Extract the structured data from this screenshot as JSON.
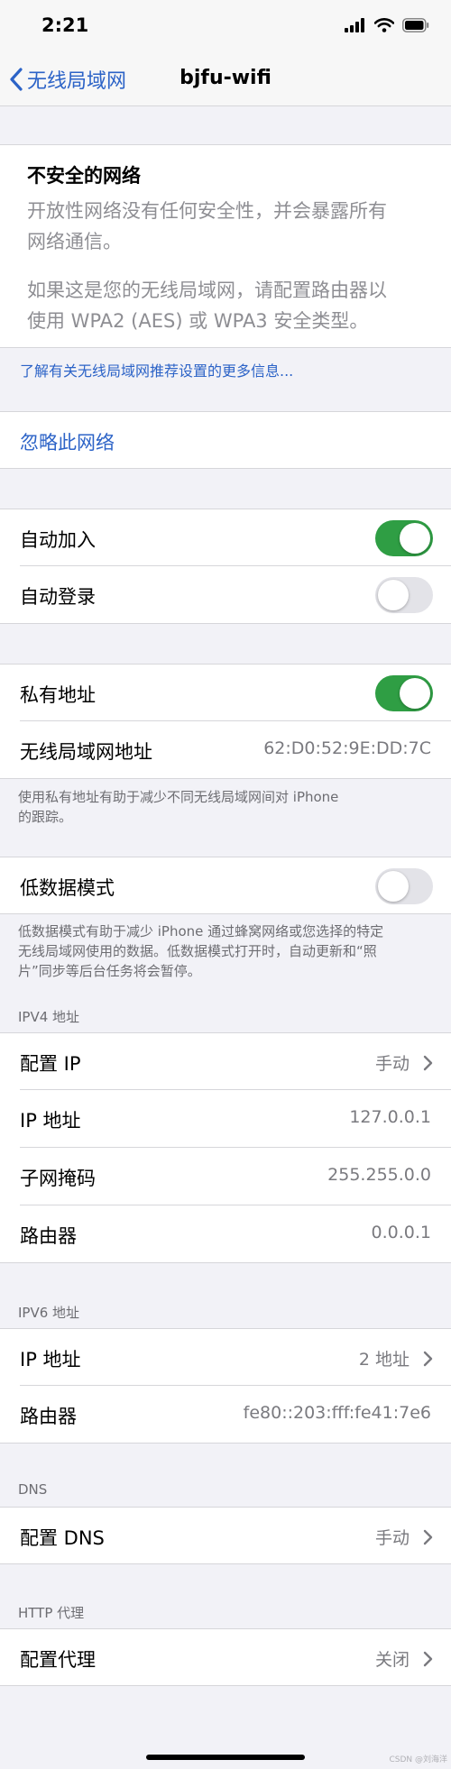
{
  "status_bar": {
    "time": "2:21"
  },
  "nav": {
    "back_label": "无线局域网",
    "title": "bjfu-wifi"
  },
  "warning": {
    "title": "不安全的网络",
    "line1": "开放性网络没有任何安全性，并会暴露所有",
    "line2": "网络通信。",
    "line3": "如果这是您的无线局域网，请配置路由器以",
    "line4": "使用 WPA2 (AES) 或 WPA3 安全类型。"
  },
  "learn_more": "了解有关无线局域网推荐设置的更多信息...",
  "forget_network": "忽略此网络",
  "auto": {
    "auto_join": {
      "label": "自动加入",
      "on": true
    },
    "auto_login": {
      "label": "自动登录",
      "on": false
    }
  },
  "privacy": {
    "private_address": {
      "label": "私有地址",
      "on": true
    },
    "wifi_address": {
      "label": "无线局域网地址",
      "value": "62:D0:52:9E:DD:7C"
    },
    "footnote_line1": "使用私有地址有助于减少不同无线局域网间对 iPhone",
    "footnote_line2": "的跟踪。"
  },
  "low_data": {
    "label": "低数据模式",
    "on": false,
    "footnote_line1": "低数据模式有助于减少 iPhone 通过蜂窝网络或您选择的特定",
    "footnote_line2": "无线局域网使用的数据。低数据模式打开时，自动更新和“照",
    "footnote_line3": "片”同步等后台任务将会暂停。"
  },
  "ipv4": {
    "header": "IPV4 地址",
    "configure_ip": {
      "label": "配置 IP",
      "value": "手动"
    },
    "ip_address": {
      "label": "IP 地址",
      "value": "127.0.0.1"
    },
    "subnet_mask": {
      "label": "子网掩码",
      "value": "255.255.0.0"
    },
    "router": {
      "label": "路由器",
      "value": "0.0.0.1"
    }
  },
  "ipv6": {
    "header": "IPV6 地址",
    "ip_address": {
      "label": "IP 地址",
      "value": "2 地址"
    },
    "router": {
      "label": "路由器",
      "value": "fe80::203:fff:fe41:7e6"
    }
  },
  "dns": {
    "header": "DNS",
    "configure_dns": {
      "label": "配置 DNS",
      "value": "手动"
    }
  },
  "http_proxy": {
    "header": "HTTP 代理",
    "configure_proxy": {
      "label": "配置代理",
      "value": "关闭"
    }
  },
  "watermark": "CSDN @刘海洋",
  "colors": {
    "accent": "#2c63c7",
    "toggle_on": "#2f9e44",
    "toggle_off": "#e3e3e8"
  }
}
